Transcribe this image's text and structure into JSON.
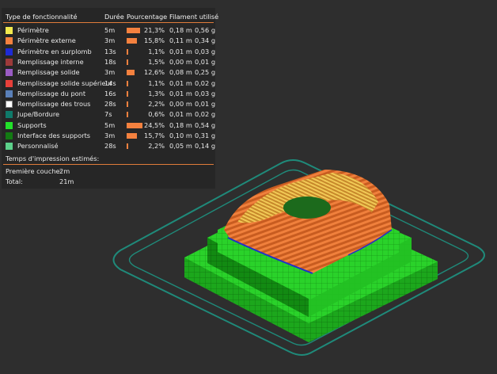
{
  "legend": {
    "headers": {
      "feature_type": "Type de fonctionnalité",
      "duration": "Durée",
      "percentage": "Pourcentage",
      "filament": "Filament utilisé"
    },
    "rows": [
      {
        "label": "Périmètre",
        "color": "#f2e94e",
        "duration": "5m",
        "percent": "21,3%",
        "percent_value": 21.3,
        "length": "0,18 m",
        "weight": "0,56 g"
      },
      {
        "label": "Périmètre externe",
        "color": "#f4813f",
        "duration": "3m",
        "percent": "15,8%",
        "percent_value": 15.8,
        "length": "0,11 m",
        "weight": "0,34 g"
      },
      {
        "label": "Périmètre en surplomb",
        "color": "#1e2bd4",
        "duration": "13s",
        "percent": "1,1%",
        "percent_value": 1.1,
        "length": "0,01 m",
        "weight": "0,03 g"
      },
      {
        "label": "Remplissage interne",
        "color": "#9c3a3a",
        "duration": "18s",
        "percent": "1,5%",
        "percent_value": 1.5,
        "length": "0,00 m",
        "weight": "0,01 g"
      },
      {
        "label": "Remplissage solide",
        "color": "#9a5cc4",
        "duration": "3m",
        "percent": "12,6%",
        "percent_value": 12.6,
        "length": "0,08 m",
        "weight": "0,25 g"
      },
      {
        "label": "Remplissage solide supérieur",
        "color": "#e8403a",
        "duration": "14s",
        "percent": "1,1%",
        "percent_value": 1.1,
        "length": "0,01 m",
        "weight": "0,02 g"
      },
      {
        "label": "Remplissage du pont",
        "color": "#5a80b8",
        "duration": "16s",
        "percent": "1,3%",
        "percent_value": 1.3,
        "length": "0,01 m",
        "weight": "0,03 g"
      },
      {
        "label": "Remplissage des trous",
        "color": "#ffffff",
        "duration": "28s",
        "percent": "2,2%",
        "percent_value": 2.2,
        "length": "0,00 m",
        "weight": "0,01 g"
      },
      {
        "label": "Jupe/Bordure",
        "color": "#0f7a6a",
        "duration": "7s",
        "percent": "0,6%",
        "percent_value": 0.6,
        "length": "0,01 m",
        "weight": "0,02 g"
      },
      {
        "label": "Supports",
        "color": "#22e02a",
        "duration": "5m",
        "percent": "24,5%",
        "percent_value": 24.5,
        "length": "0,18 m",
        "weight": "0,54 g"
      },
      {
        "label": "Interface des supports",
        "color": "#137a13",
        "duration": "3m",
        "percent": "15,7%",
        "percent_value": 15.7,
        "length": "0,10 m",
        "weight": "0,31 g"
      },
      {
        "label": "Personnalisé",
        "color": "#5cd08a",
        "duration": "28s",
        "percent": "2,2%",
        "percent_value": 2.2,
        "length": "0,05 m",
        "weight": "0,14 g"
      }
    ],
    "bar_color": "#f4813f",
    "estimates_title": "Temps d'impression estimés:",
    "first_layer_label": "Première couche:",
    "first_layer_value": "2m",
    "total_label": "Total:",
    "total_value": "21m"
  },
  "colors": {
    "background": "#2e2e2e",
    "legend_background": "#262626",
    "separator": "#e07b3a",
    "bed_outline": "#1f8a7a"
  }
}
